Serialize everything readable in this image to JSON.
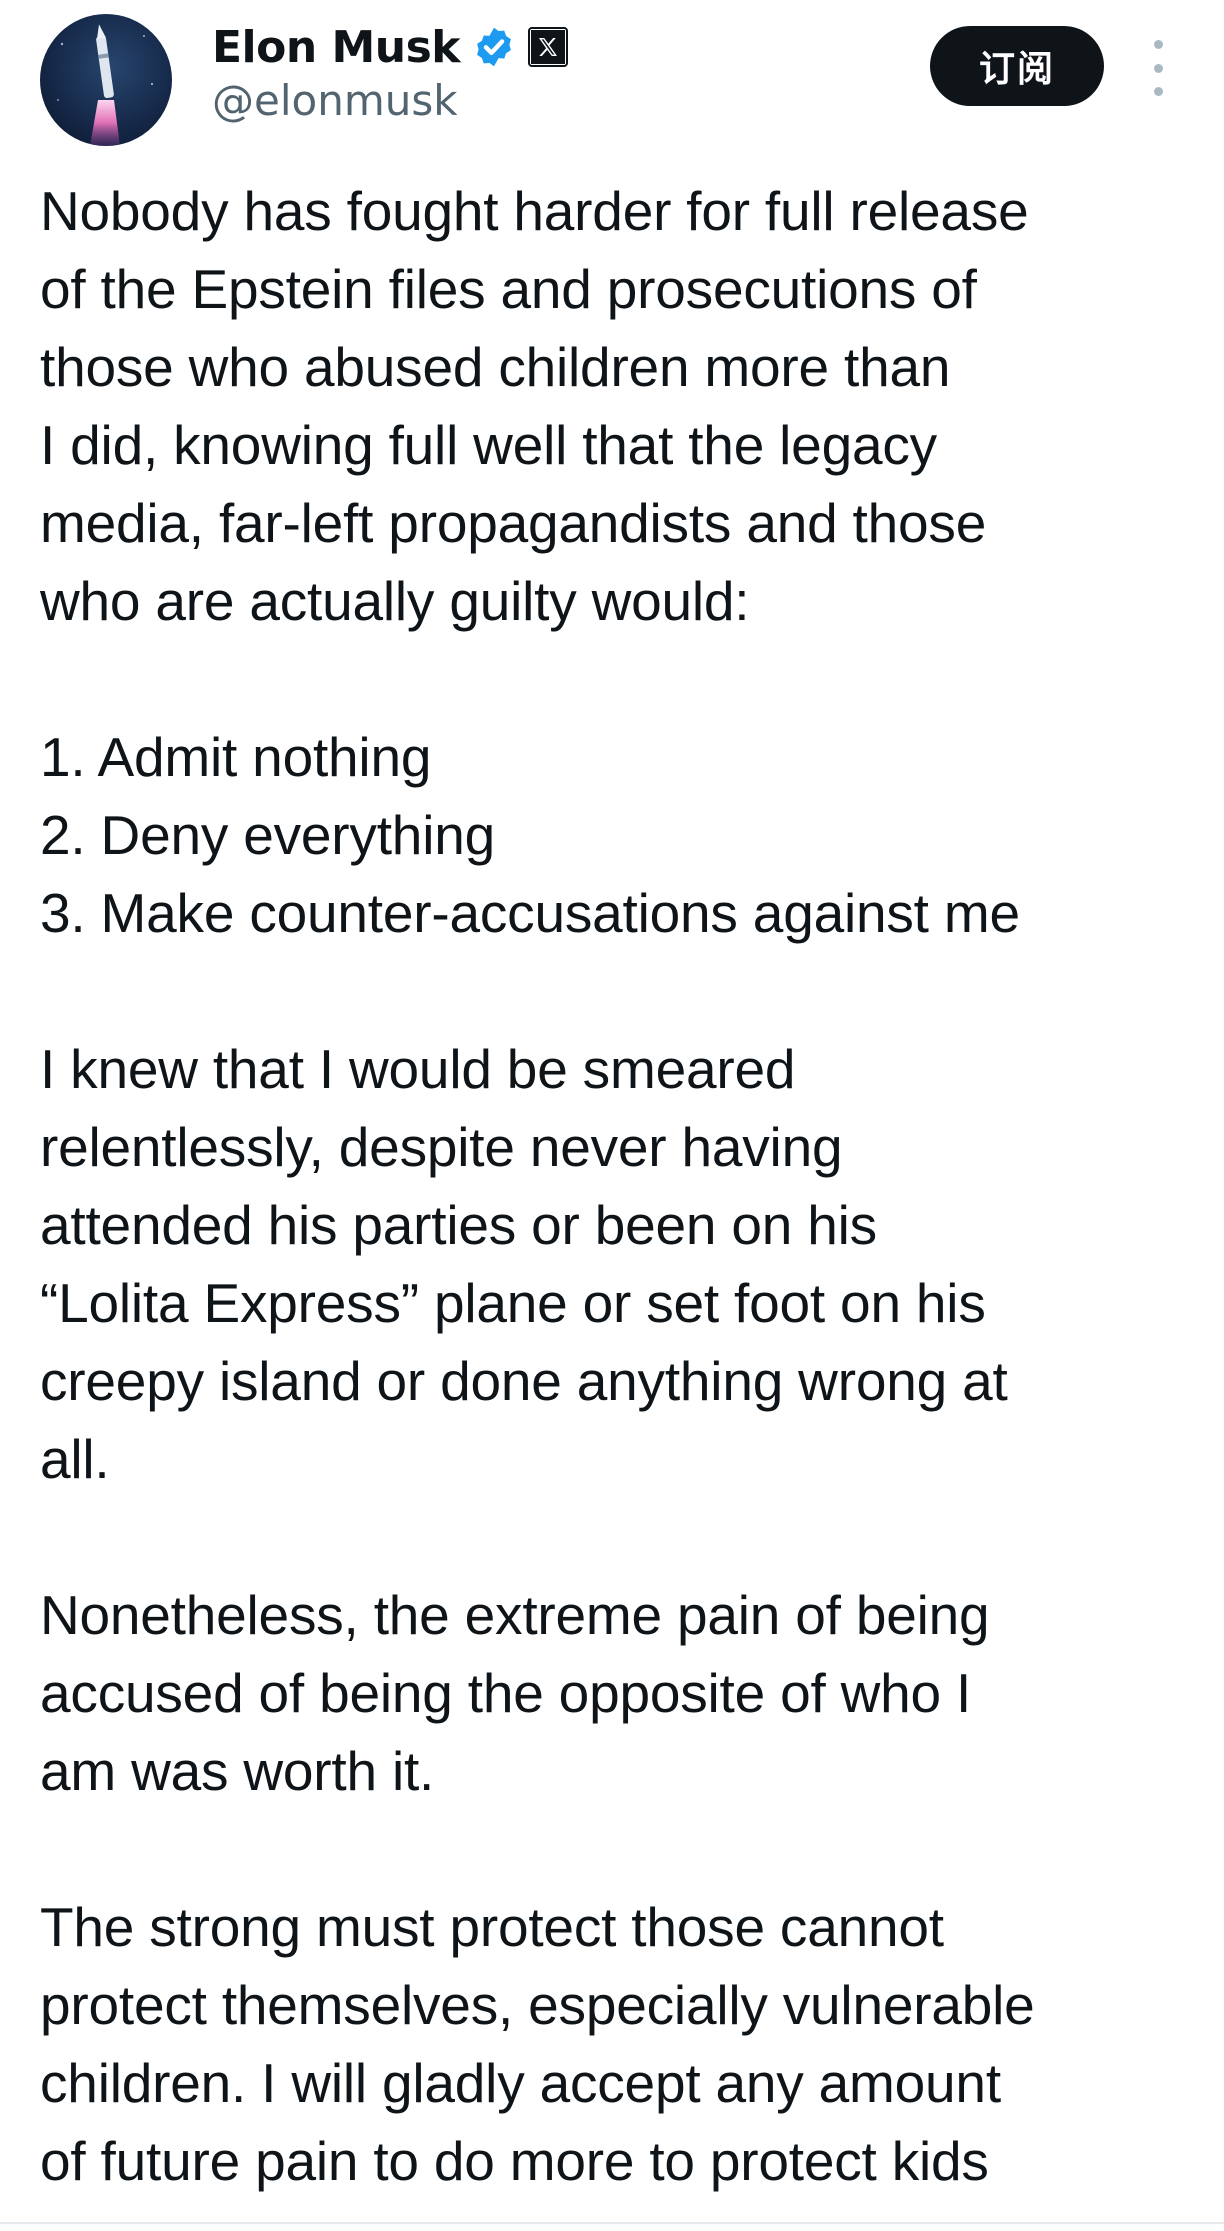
{
  "author": {
    "display_name": "Elon Musk",
    "handle": "@elonmusk",
    "avatar_icon": "rocket-launch-avatar",
    "verified_icon": "verified-badge-icon",
    "affiliation_icon": "x-logo-icon"
  },
  "actions": {
    "subscribe_label": "订阅",
    "more_icon": "more-vertical-icon"
  },
  "tweet": {
    "paragraphs": [
      {
        "lines": [
          "Nobody has fought harder for full release",
          "of the Epstein files and prosecutions of",
          "those who abused children more than",
          "I did, knowing full well that the legacy",
          "media, far-left propagandists and those",
          "who are actually guilty would:"
        ]
      },
      {
        "lines": [
          "1. Admit nothing",
          "2. Deny everything",
          "3. Make counter-accusations against me"
        ]
      },
      {
        "lines": [
          "I knew that I would be smeared",
          "relentlessly, despite never having",
          "attended his parties or been on his",
          "“Lolita Express” plane or set foot on his",
          "creepy island or done anything wrong at",
          "all."
        ]
      },
      {
        "lines": [
          "Nonetheless, the extreme pain of being",
          "accused of being the opposite of who I",
          "am was worth it."
        ]
      },
      {
        "lines": [
          "The strong must protect those cannot",
          "protect themselves, especially vulnerable",
          "children. I will gladly accept any amount",
          "of future pain to do more to protect kids"
        ]
      }
    ]
  },
  "colors": {
    "text_primary": "#0f1419",
    "text_secondary": "#536471",
    "verified_blue": "#1d9bf0",
    "button_bg": "#0f1419",
    "button_text": "#ffffff"
  }
}
